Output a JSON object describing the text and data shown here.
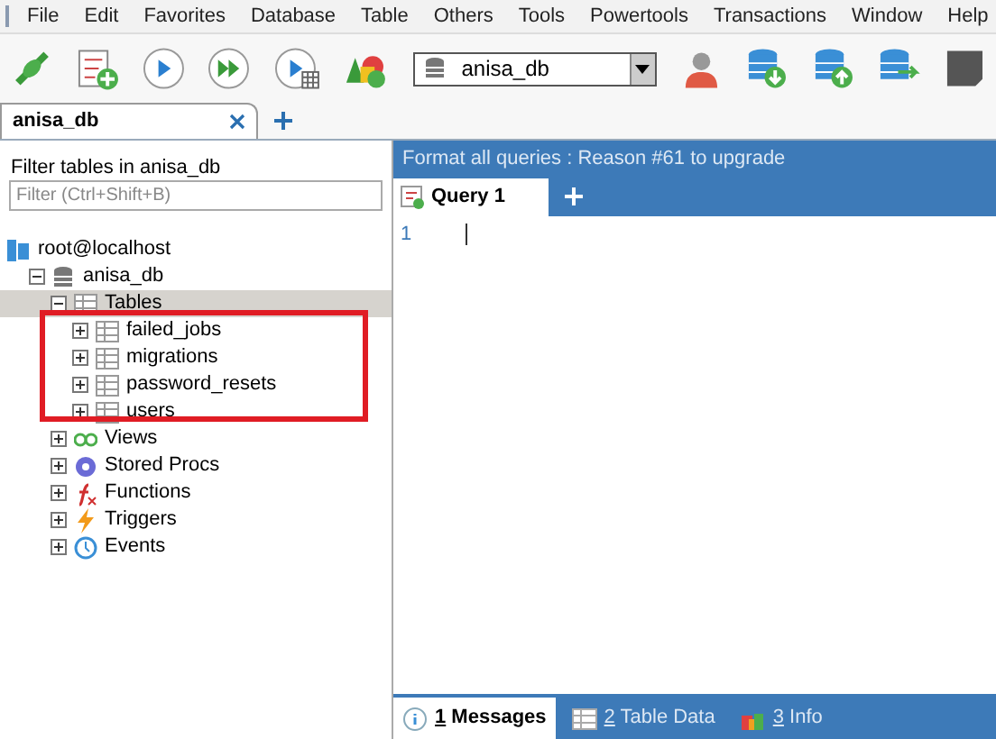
{
  "menu": [
    "File",
    "Edit",
    "Favorites",
    "Database",
    "Table",
    "Others",
    "Tools",
    "Powertools",
    "Transactions",
    "Window",
    "Help"
  ],
  "toolbar": {
    "database_select": "anisa_db"
  },
  "connection_tabs": [
    {
      "label": "anisa_db",
      "selected": true
    }
  ],
  "object_browser": {
    "title": "Filter tables in anisa_db",
    "filter": {
      "placeholder": "Filter (Ctrl+Shift+B)"
    },
    "tree": [
      {
        "label": "root@localhost",
        "kind": "server",
        "children": [
          {
            "label": "anisa_db",
            "kind": "database",
            "expanded": true,
            "selected": false,
            "children": [
              {
                "label": "Tables",
                "kind": "folder",
                "expanded": true,
                "selected": true,
                "children": [
                  {
                    "label": "failed_jobs",
                    "kind": "table",
                    "expanded": false,
                    "selected": false
                  },
                  {
                    "label": "migrations",
                    "kind": "table",
                    "expanded": false,
                    "selected": false
                  },
                  {
                    "label": "password_resets",
                    "kind": "table",
                    "expanded": false,
                    "selected": false
                  },
                  {
                    "label": "users",
                    "kind": "table",
                    "expanded": false,
                    "selected": false
                  }
                ]
              },
              {
                "label": "Views",
                "kind": "views",
                "expanded": false,
                "selected": false
              },
              {
                "label": "Stored Procs",
                "kind": "procs",
                "expanded": false,
                "selected": false
              },
              {
                "label": "Functions",
                "kind": "functions",
                "expanded": false,
                "selected": false
              },
              {
                "label": "Triggers",
                "kind": "triggers",
                "expanded": false,
                "selected": false
              },
              {
                "label": "Events",
                "kind": "events",
                "expanded": false,
                "selected": false
              }
            ]
          }
        ]
      }
    ]
  },
  "banner": "Format all queries : Reason #61 to upgrade",
  "query_tabs": [
    {
      "label": "Query 1",
      "selected": true
    }
  ],
  "editor": {
    "line_numbers": [
      "1"
    ]
  },
  "result_tabs": [
    {
      "key": "1",
      "label": "Messages",
      "kind": "messages",
      "selected": true
    },
    {
      "key": "2",
      "label": "Table Data",
      "kind": "table",
      "selected": false
    },
    {
      "key": "3",
      "label": "Info",
      "kind": "info",
      "selected": false
    }
  ]
}
